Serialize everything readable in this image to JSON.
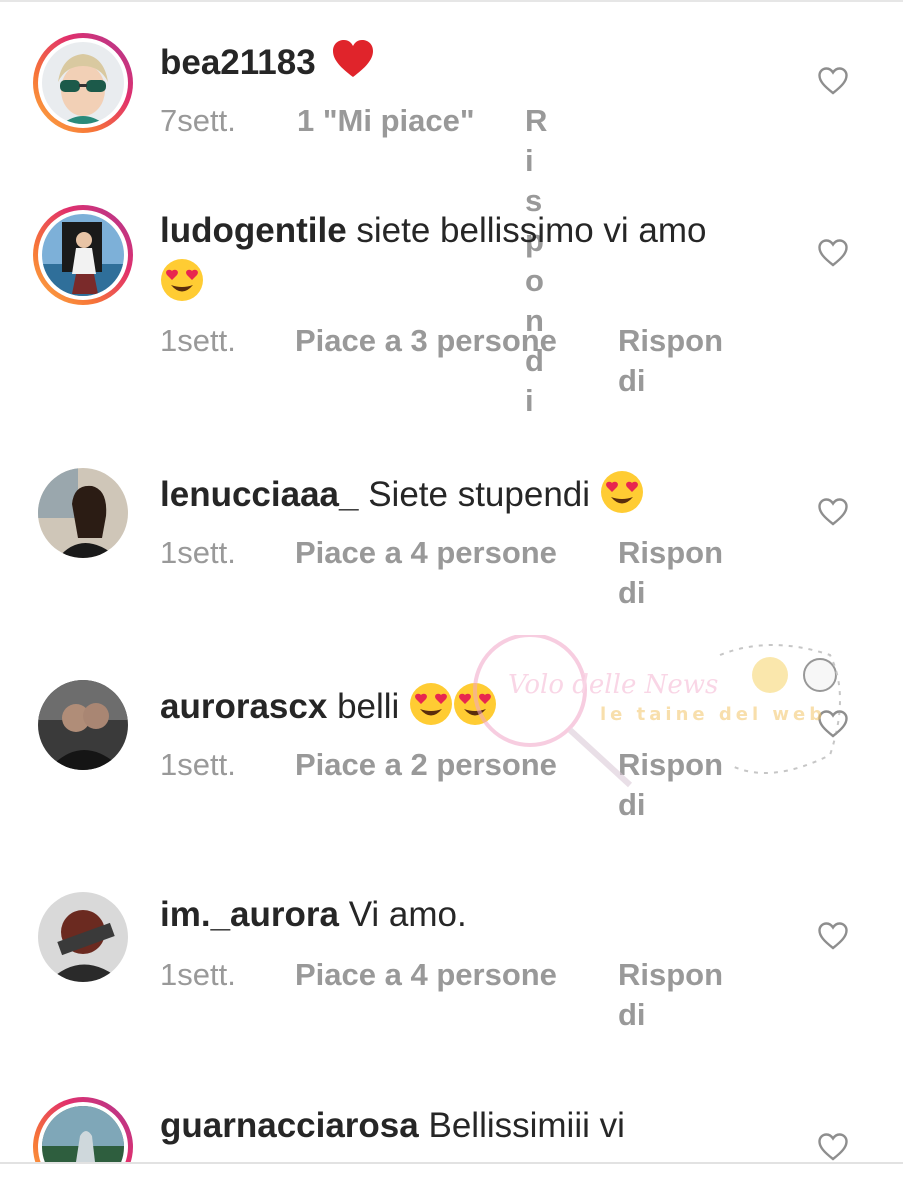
{
  "comments": [
    {
      "username": "bea21183",
      "text": "",
      "emoji": "heart",
      "time": "7sett.",
      "likes": "1 \"Mi piace\"",
      "reply": "Rispondi"
    },
    {
      "username": "ludogentile",
      "text": "siete bellissimo vi amo",
      "emoji": "heart-eyes",
      "time": "1sett.",
      "likes": "Piace a 3 persone",
      "reply": "Rispondi"
    },
    {
      "username": "lenucciaaa_",
      "text": "Siete stupendi",
      "emoji": "heart-eyes",
      "time": "1sett.",
      "likes": "Piace a 4 persone",
      "reply": "Rispondi"
    },
    {
      "username": "aurorascx",
      "text": "belli",
      "emoji": "heart-eyes x2",
      "time": "1sett.",
      "likes": "Piace a 2 persone",
      "reply": "Rispondi"
    },
    {
      "username": "im._aurora",
      "text": "Vi amo.",
      "emoji": "",
      "time": "1sett.",
      "likes": "Piace a 4 persone",
      "reply": "Rispondi"
    },
    {
      "username": "guarnacciarosa",
      "text": "Bellissimiii vi",
      "emoji": "",
      "time": "",
      "likes": "",
      "reply": ""
    }
  ],
  "watermark": {
    "main": "Volo delle News",
    "side": "le taine del web"
  },
  "colors": {
    "meta_text": "#999999",
    "heart_red": "#e0242b",
    "story_ring": "#e1306c"
  }
}
